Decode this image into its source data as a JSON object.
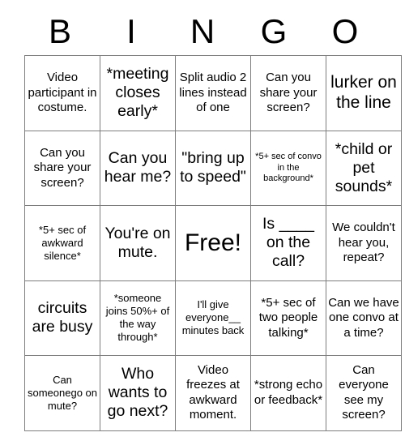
{
  "card": {
    "title_letters": [
      "B",
      "I",
      "N",
      "G",
      "O"
    ],
    "rows": [
      [
        {
          "text": "Video participant in costume.",
          "size": "t-md"
        },
        {
          "text": "*meeting closes early*",
          "size": "t-lg"
        },
        {
          "text": "Split audio 2 lines instead of one",
          "size": "t-md"
        },
        {
          "text": "Can you share your screen?",
          "size": "t-md"
        },
        {
          "text": "lurker on the line",
          "size": "t-xl"
        }
      ],
      [
        {
          "text": "Can you share your screen?",
          "size": "t-md"
        },
        {
          "text": "Can you hear me?",
          "size": "t-lg"
        },
        {
          "text": "\"bring up to speed\"",
          "size": "t-lg"
        },
        {
          "text": "*5+ sec of convo in the background*",
          "size": "t-xs"
        },
        {
          "text": "*child or pet sounds*",
          "size": "t-lg"
        }
      ],
      [
        {
          "text": "*5+ sec of awkward silence*",
          "size": "t-sm"
        },
        {
          "text": "You're on mute.",
          "size": "t-lg"
        },
        {
          "text": "Free!",
          "size": "t-free"
        },
        {
          "text": "Is ____ on the call?",
          "size": "t-lg"
        },
        {
          "text": "We couldn't hear you, repeat?",
          "size": "t-md"
        }
      ],
      [
        {
          "text": "circuits are busy",
          "size": "t-lg"
        },
        {
          "text": "*someone joins 50%+ of the way through*",
          "size": "t-sm"
        },
        {
          "text": "I'll give everyone__ minutes back",
          "size": "t-sm"
        },
        {
          "text": "*5+ sec of two people talking*",
          "size": "t-md"
        },
        {
          "text": "Can we have one convo at a time?",
          "size": "t-md"
        }
      ],
      [
        {
          "text": "Can someonego on mute?",
          "size": "t-sm"
        },
        {
          "text": "Who wants to go next?",
          "size": "t-lg"
        },
        {
          "text": "Video freezes at awkward moment.",
          "size": "t-md"
        },
        {
          "text": "*strong echo or feedback*",
          "size": "t-md"
        },
        {
          "text": "Can everyone see my screen?",
          "size": "t-md"
        }
      ]
    ],
    "colors": {
      "border": "#7d7d7d",
      "text": "#000000",
      "background": "#ffffff"
    }
  }
}
